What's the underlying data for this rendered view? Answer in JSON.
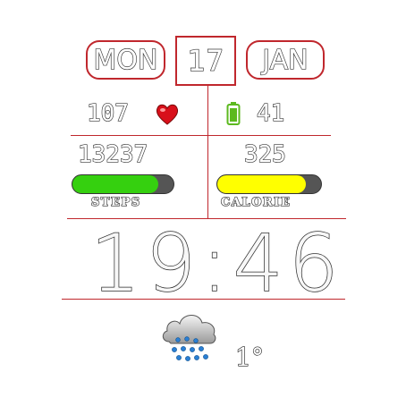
{
  "date": {
    "weekday": "MON",
    "day": "17",
    "month": "JAN"
  },
  "health": {
    "heart_rate": "107",
    "heart_icon": "heart-icon"
  },
  "battery": {
    "level": "41",
    "icon": "battery-icon"
  },
  "steps": {
    "value": "13237",
    "label": "STEPS",
    "progress": 0.85
  },
  "calories": {
    "value": "325",
    "label": "CALORIE",
    "progress": 0.85
  },
  "clock": {
    "time": "19:46"
  },
  "weather": {
    "temperature": "1°",
    "icon": "rain-cloud-icon"
  },
  "colors": {
    "accent": "#c0272d",
    "steps_fill": "#35d00f",
    "calorie_fill": "#ffff00",
    "battery_green": "#5cb91f"
  }
}
